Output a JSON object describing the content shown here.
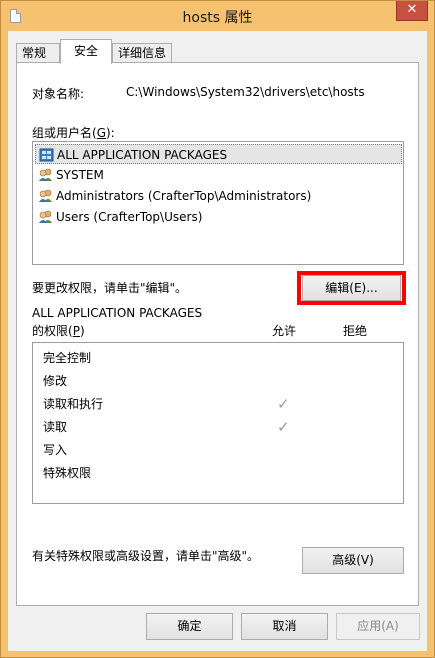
{
  "window": {
    "title": "hosts 属性",
    "close_glyph": "✕"
  },
  "tabs": [
    {
      "label": "常规",
      "active": false
    },
    {
      "label": "安全",
      "active": true
    },
    {
      "label": "详细信息",
      "active": false
    }
  ],
  "security": {
    "object_name_label": "对象名称:",
    "object_name_value": "C:\\Windows\\System32\\drivers\\etc\\hosts",
    "groups_label_prefix": "组或用户名(",
    "groups_label_key": "G",
    "groups_label_suffix": "):",
    "users": [
      {
        "name": "ALL APPLICATION PACKAGES",
        "icon": "app-packages-icon",
        "selected": true
      },
      {
        "name": "SYSTEM",
        "icon": "users-icon",
        "selected": false
      },
      {
        "name": "Administrators (CrafterTop\\Administrators)",
        "icon": "users-icon",
        "selected": false
      },
      {
        "name": "Users (CrafterTop\\Users)",
        "icon": "users-icon",
        "selected": false
      }
    ],
    "change_hint": "要更改权限，请单击\"编辑\"。",
    "edit_button": "编辑(E)...",
    "perm_for_line1": "ALL APPLICATION PACKAGES",
    "perm_for_prefix": "的权限(",
    "perm_for_key": "P",
    "perm_for_suffix": ")",
    "allow_header": "允许",
    "deny_header": "拒绝",
    "permissions": [
      {
        "name": "完全控制",
        "allow": "",
        "deny": ""
      },
      {
        "name": "修改",
        "allow": "",
        "deny": ""
      },
      {
        "name": "读取和执行",
        "allow": "✓",
        "deny": ""
      },
      {
        "name": "读取",
        "allow": "✓",
        "deny": ""
      },
      {
        "name": "写入",
        "allow": "",
        "deny": ""
      },
      {
        "name": "特殊权限",
        "allow": "",
        "deny": ""
      }
    ],
    "advanced_hint": "有关特殊权限或高级设置，请单击\"高级\"。",
    "advanced_button": "高级(V)"
  },
  "footer": {
    "ok": "确定",
    "cancel": "取消",
    "apply": "应用(A)"
  },
  "colors": {
    "titlebar": "#f7c26f",
    "close": "#c7503f",
    "highlight": "#ff0000"
  }
}
